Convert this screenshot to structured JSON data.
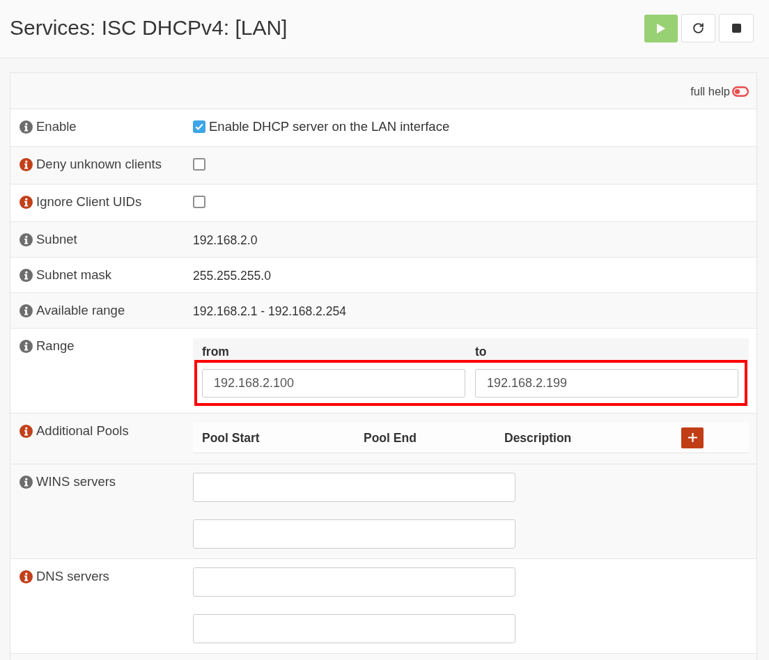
{
  "page": {
    "title": "Services: ISC DHCPv4: [LAN]"
  },
  "toolbar": [
    {
      "kind": "start"
    },
    {
      "kind": "restart"
    },
    {
      "kind": "stop"
    }
  ],
  "help_toggle": {
    "label": "full help",
    "on": false
  },
  "rows": [
    {
      "kind": "checkbox",
      "label": "Enable",
      "color": "#6d6d6d",
      "checked": true,
      "text": "Enable DHCP server on the LAN interface"
    },
    {
      "kind": "checkbox",
      "label": "Deny unknown clients",
      "color": "#c2401a",
      "checked": false
    },
    {
      "kind": "checkbox",
      "label": "Ignore Client UIDs",
      "color": "#c2401a",
      "checked": false
    },
    {
      "kind": "text",
      "label": "Subnet",
      "color": "#6d6d6d",
      "value": "192.168.2.0"
    },
    {
      "kind": "text",
      "label": "Subnet mask",
      "color": "#6d6d6d",
      "value": "255.255.255.0"
    },
    {
      "kind": "text",
      "label": "Available range",
      "color": "#6d6d6d",
      "value": "192.168.2.1 - 192.168.2.254"
    },
    {
      "kind": "range",
      "label": "Range",
      "color": "#6d6d6d",
      "columns": [
        "from",
        "to"
      ],
      "values": [
        "192.168.2.100",
        "192.168.2.199"
      ],
      "highlighted": true
    },
    {
      "kind": "pools",
      "label": "Additional Pools",
      "color": "#c2401a",
      "columns": [
        "Pool Start",
        "Pool End",
        "Description"
      ]
    },
    {
      "kind": "inputs",
      "label": "WINS servers",
      "color": "#6d6d6d",
      "fields": [
        {
          "kind": "text"
        },
        {
          "kind": "text"
        }
      ]
    },
    {
      "kind": "inputs",
      "label": "DNS servers",
      "color": "#c2401a",
      "fields": [
        {
          "kind": "text"
        },
        {
          "kind": "text"
        }
      ]
    }
  ]
}
